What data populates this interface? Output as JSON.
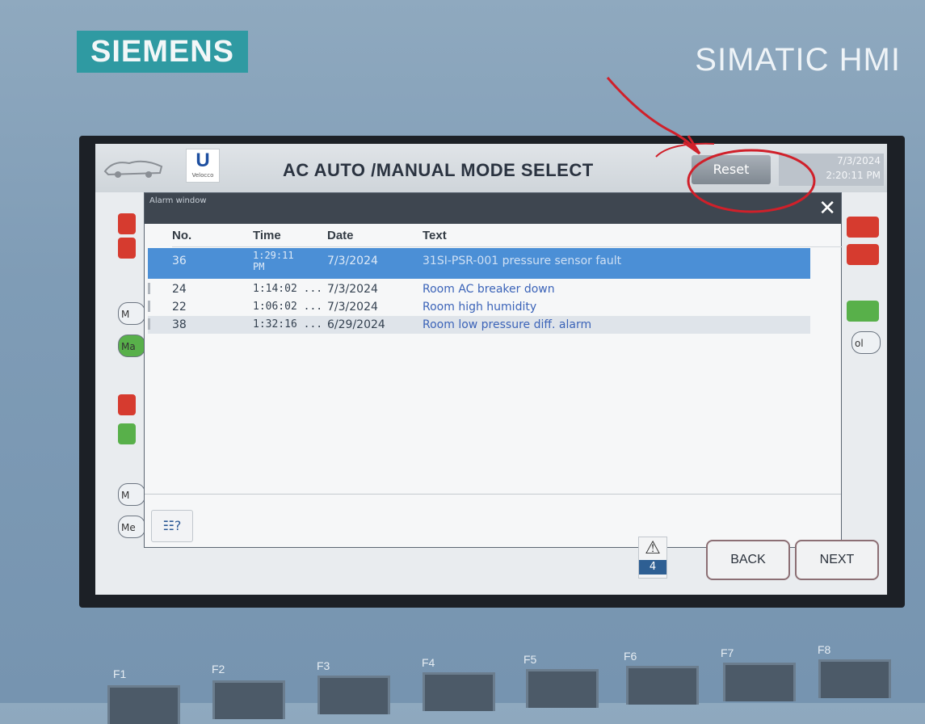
{
  "bezel": {
    "brand_logo": "SIEMENS",
    "product": "SIMATIC HMI"
  },
  "topbar": {
    "logo_text": "U",
    "logo_subtext": "Velocco",
    "title": "AC AUTO /MANUAL MODE SELECT",
    "reset_label": "Reset",
    "date": "7/3/2024",
    "time": "2:20:11 PM"
  },
  "alarm_window": {
    "title": "Alarm window",
    "columns": [
      "No.",
      "Time",
      "Date",
      "Text"
    ],
    "rows": [
      {
        "no": "36",
        "time": "1:29:11 PM",
        "date": "7/3/2024",
        "text": "31SI-PSR-001 pressure sensor fault"
      },
      {
        "no": "24",
        "time": "1:14:02 ...",
        "date": "7/3/2024",
        "text": "Room AC breaker down"
      },
      {
        "no": "22",
        "time": "1:06:02 ...",
        "date": "7/3/2024",
        "text": "Room high humidity"
      },
      {
        "no": "38",
        "time": "1:32:16 ...",
        "date": "6/29/2024",
        "text": "Room low pressure diff. alarm"
      }
    ]
  },
  "footer": {
    "alarm_count": "4",
    "back_label": "BACK",
    "next_label": "NEXT"
  },
  "side_labels": {
    "left_m": "M",
    "left_ma": "Ma",
    "left_me": "Me",
    "right_off": "ol"
  },
  "function_keys": [
    "F1",
    "F2",
    "F3",
    "F4",
    "F5",
    "F6",
    "F7",
    "F8"
  ],
  "colors": {
    "logo_teal": "#2f9aa2",
    "selected_row": "#4b8fd6",
    "annotation_red": "#d0202a"
  }
}
